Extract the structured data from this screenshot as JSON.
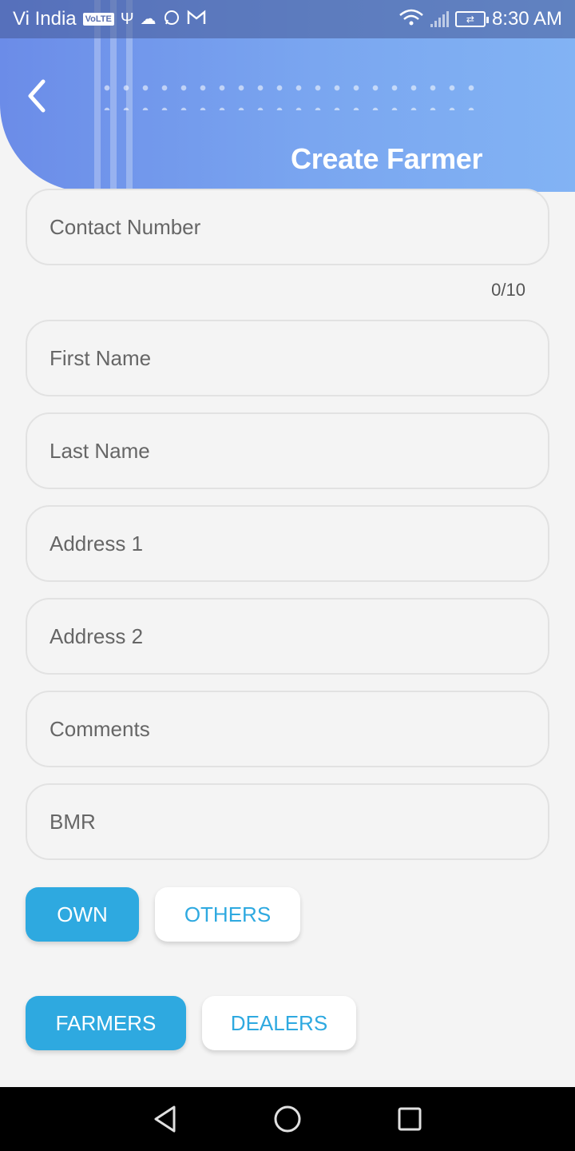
{
  "status_bar": {
    "carrier": "Vi India",
    "volte_badge": "VoLTE",
    "time": "8:30 AM",
    "icons": [
      "usb-icon",
      "cloud-icon",
      "whatsapp-icon",
      "gmail-icon",
      "wifi-icon",
      "signal-icon",
      "battery-icon"
    ]
  },
  "header": {
    "title": "Create Farmer",
    "back_icon": "chevron-left-icon",
    "gradient_start": "#6b8ce8",
    "gradient_end": "#82b3f4"
  },
  "form": {
    "contact_number": {
      "placeholder": "Contact Number",
      "value": ""
    },
    "contact_counter": "0/10",
    "first_name": {
      "placeholder": "First Name",
      "value": ""
    },
    "last_name": {
      "placeholder": "Last Name",
      "value": ""
    },
    "address1": {
      "placeholder": "Address 1",
      "value": ""
    },
    "address2": {
      "placeholder": "Address 2",
      "value": ""
    },
    "comments": {
      "placeholder": "Comments",
      "value": ""
    },
    "bmr": {
      "placeholder": "BMR",
      "value": ""
    }
  },
  "ownership_toggle": {
    "own_label": "OWN",
    "others_label": "OTHERS",
    "selected": "OWN"
  },
  "type_toggle": {
    "farmers_label": "FARMERS",
    "dealers_label": "DEALERS",
    "selected": "FARMERS"
  },
  "colors": {
    "accent": "#2ea9e0",
    "background": "#f4f4f4"
  },
  "nav_bar": {
    "icons": [
      "back-triangle-icon",
      "home-circle-icon",
      "recents-square-icon"
    ]
  }
}
